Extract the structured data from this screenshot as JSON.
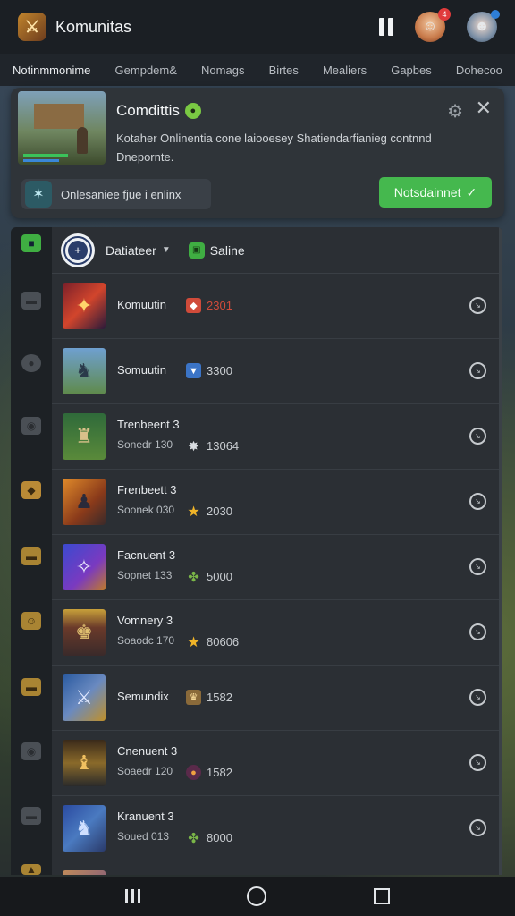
{
  "app": {
    "title": "Komunitas",
    "logo_glyph": "⚔"
  },
  "header": {
    "notification_count": "4"
  },
  "tabs": [
    {
      "label": "Notinmmonime"
    },
    {
      "label": "Gempdem&"
    },
    {
      "label": "Nomags"
    },
    {
      "label": "Birtes"
    },
    {
      "label": "Mealiers"
    },
    {
      "label": "Gapbes"
    },
    {
      "label": "Dohecoo"
    }
  ],
  "notification": {
    "title": "Comdittis",
    "body": "Kotaher Onlinentia cone laiooesey Shatiendarfianieg contnnd Dnepornte.",
    "pill_text": "Onlesaniee fjue i enlinx",
    "action_label": "Notsdainnet",
    "colors": {
      "accent": "#45b84e"
    }
  },
  "filter": {
    "selected": "Datiateer",
    "status_label": "Saline"
  },
  "players": [
    {
      "name": "Komuutin",
      "score": "2301",
      "icon": "fire-icon",
      "score_color": "#d04b3a"
    },
    {
      "name": "Somuutin",
      "score": "3300",
      "icon": "shield-icon"
    },
    {
      "name": "Trenbeent 3",
      "sub": "Sonedr 130",
      "score": "13064",
      "icon": "star-icon"
    },
    {
      "name": "Frenbeett 3",
      "sub": "Soonek 030",
      "score": "2030",
      "icon": "star-icon"
    },
    {
      "name": "Facnuent 3",
      "sub": "Sopnet 133",
      "score": "5000",
      "icon": "leaf-icon"
    },
    {
      "name": "Vomnery 3",
      "sub": "Soaodc 170",
      "score": "80606",
      "icon": "star-icon"
    },
    {
      "name": "Semundix",
      "score": "1582",
      "icon": "trophy-icon"
    },
    {
      "name": "Cnenuent 3",
      "sub": "Soaedr 120",
      "score": "1582",
      "icon": "orb-icon"
    },
    {
      "name": "Kranuent 3",
      "sub": "Soued 013",
      "score": "8000",
      "icon": "leaf-icon"
    }
  ]
}
